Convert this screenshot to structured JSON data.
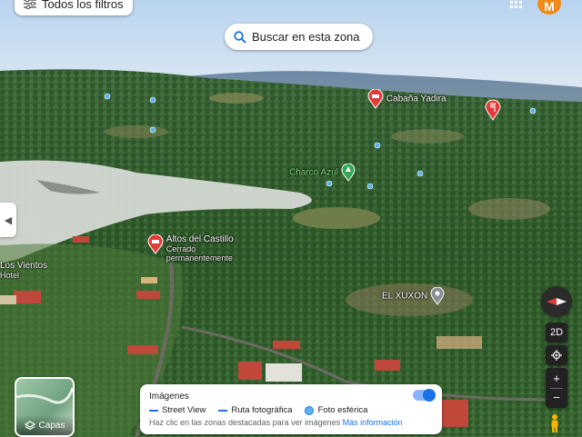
{
  "top_bar": {
    "filters_label": "Todos los filtros",
    "search_zone_label": "Buscar en esta zona",
    "avatar_initial": "M"
  },
  "places": {
    "cabana_yadira": "Cabaña Yadira",
    "charco_azul": "Charco Azul",
    "altos_del_castillo": "Altos del Castillo",
    "altos_status": "Cerrado permanentemente",
    "los_vientos": "Los Vientos",
    "los_vientos_type": "Hotel",
    "el_xuxon": "EL XUXON"
  },
  "layers": {
    "label": "Capas"
  },
  "imagery": {
    "title": "Imágenes",
    "street_view": "Street View",
    "photo_path": "Ruta fotográfica",
    "photo_sphere": "Foto esférica",
    "hint": "Haz clic en las zonas destacadas para ver imágenes",
    "more_info": "Más información",
    "toggle_on": true
  },
  "controls": {
    "view_2d": "2D",
    "zoom_in": "+",
    "zoom_out": "−"
  },
  "colors": {
    "avatar": "#f08a18",
    "accent_blue": "#1a73e8",
    "restaurant_pin": "#e53935",
    "nature_pin": "#34a853"
  }
}
